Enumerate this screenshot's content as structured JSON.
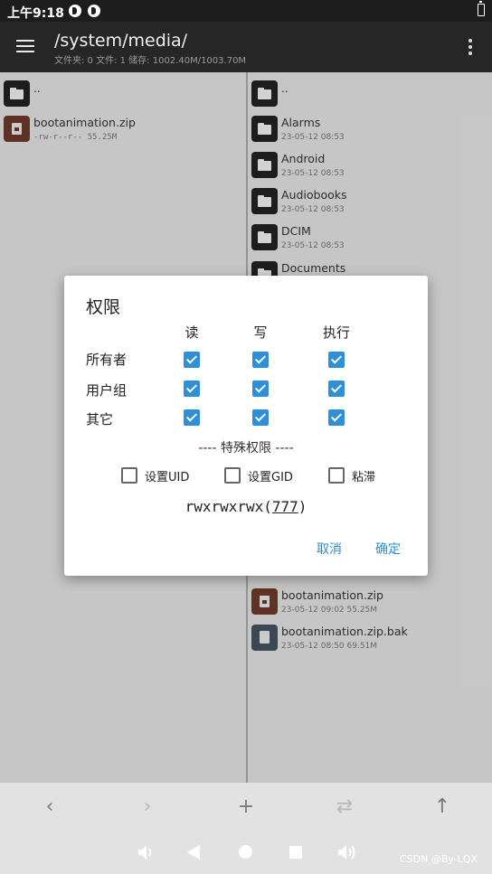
{
  "status": {
    "time": "上午9:18",
    "app_icons": [
      "f-icon",
      "f-icon"
    ],
    "battery_icon": "battery-icon"
  },
  "app_bar": {
    "title": "/system/media/",
    "subtitle": "文件夹: 0  文件: 1  储存: 1002.40M/1003.70M",
    "menu_icon": "hamburger-icon",
    "more_icon": "more-vert-icon"
  },
  "left_pane": {
    "up_label": "..",
    "files": [
      {
        "name": "bootanimation.zip",
        "meta": "-rw-r--r--  55.25M",
        "icon": "zip-icon"
      }
    ]
  },
  "right_pane": {
    "up_label": "..",
    "folders": [
      {
        "name": "Alarms",
        "meta": "23-05-12 08:53"
      },
      {
        "name": "Android",
        "meta": "23-05-12 08:53"
      },
      {
        "name": "Audiobooks",
        "meta": "23-05-12 08:53"
      },
      {
        "name": "DCIM",
        "meta": "23-05-12 08:53"
      },
      {
        "name": "Documents",
        "meta": ""
      }
    ],
    "files": [
      {
        "name": "bootanimation.zip",
        "meta": "23-05-12 09:02  55.25M",
        "icon": "zip-icon"
      },
      {
        "name": "bootanimation.zip.bak",
        "meta": "23-05-12 08:50  69.51M",
        "icon": "doc-icon"
      }
    ]
  },
  "dialog": {
    "title": "权限",
    "columns": [
      "读",
      "写",
      "执行"
    ],
    "rows": [
      {
        "label": "所有者",
        "values": [
          true,
          true,
          true
        ]
      },
      {
        "label": "用户组",
        "values": [
          true,
          true,
          true
        ]
      },
      {
        "label": "其它",
        "values": [
          true,
          true,
          true
        ]
      }
    ],
    "special_title": "---- 特殊权限 ----",
    "special": [
      {
        "label": "设置UID",
        "checked": false
      },
      {
        "label": "设置GID",
        "checked": false
      },
      {
        "label": "粘滞",
        "checked": false
      }
    ],
    "perm_prefix": "rwxrwxrwx(",
    "perm_octal": "777",
    "perm_suffix": ")",
    "cancel_label": "取消",
    "ok_label": "确定"
  },
  "bottom_bar": {
    "icons": [
      "chevron-left-icon",
      "chevron-right-icon",
      "plus-icon",
      "swap-icon",
      "arrow-up-icon"
    ],
    "glyphs": [
      "‹",
      "›",
      "+",
      "⇄",
      "↑"
    ]
  },
  "nav_bar": {
    "icons": [
      "volume-down-icon",
      "back-icon",
      "home-icon",
      "recents-icon",
      "volume-up-icon"
    ],
    "watermark": "CSDN @By-LQX"
  },
  "colors": {
    "accent": "#2f8fd8",
    "button_text": "#2a8ed6",
    "app_bar": "#262626",
    "status_bar": "#1d1d1d"
  }
}
